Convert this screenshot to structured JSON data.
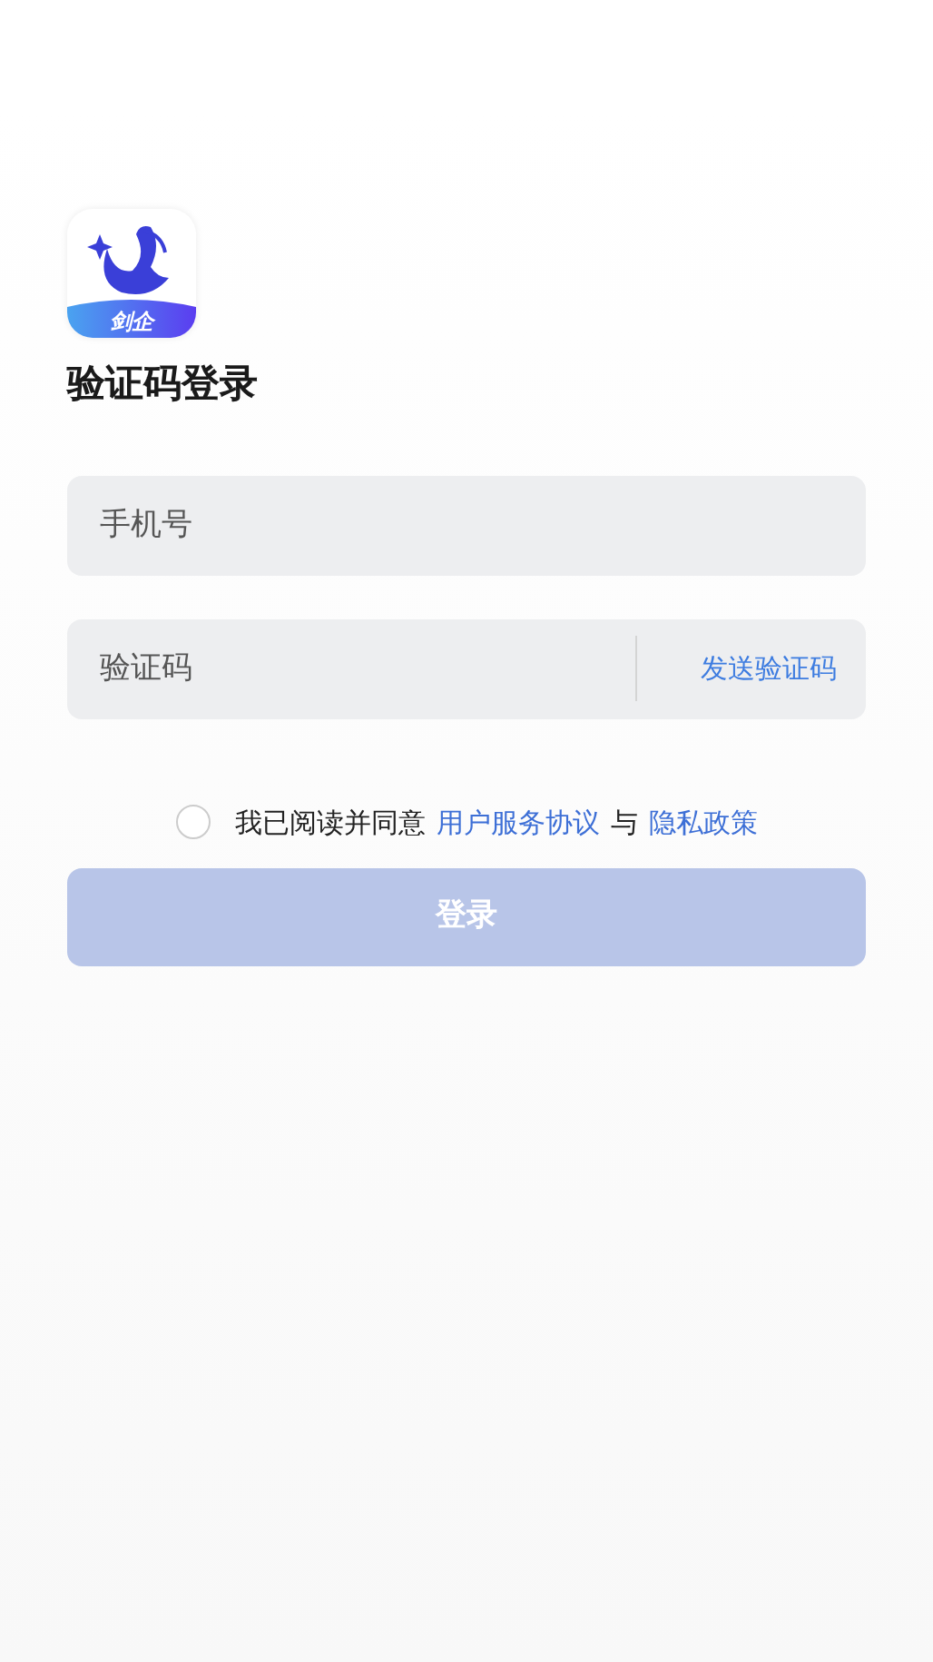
{
  "logo": {
    "text": "剑企"
  },
  "title": "验证码登录",
  "phone_field": {
    "placeholder": "手机号"
  },
  "code_field": {
    "placeholder": "验证码",
    "send_button": "发送验证码"
  },
  "agreement": {
    "checked": false,
    "parts": [
      {
        "kind": "text",
        "text": "我已阅读并同意"
      },
      {
        "kind": "link",
        "text": "用户服务协议"
      },
      {
        "kind": "text",
        "text": "与"
      },
      {
        "kind": "link",
        "text": "隐私政策"
      }
    ]
  },
  "login_button": {
    "label": "登录",
    "disabled": true
  }
}
